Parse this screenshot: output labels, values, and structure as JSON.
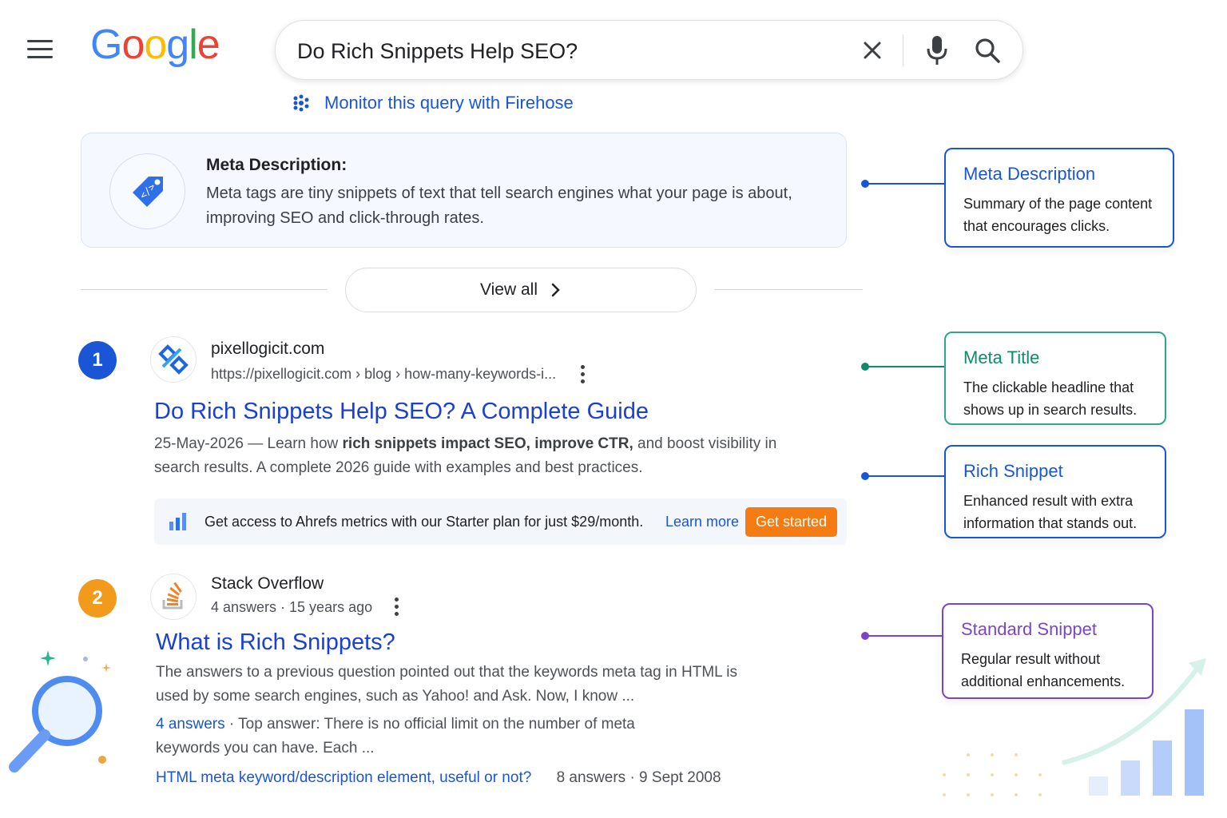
{
  "header": {
    "logo_letters": [
      "G",
      "o",
      "o",
      "g",
      "l",
      "e"
    ],
    "logo_colors": [
      "#4285F4",
      "#EA4335",
      "#FBBC05",
      "#4285F4",
      "#34A853",
      "#EA4335"
    ],
    "search_query": "Do Rich Snippets Help SEO?",
    "icons": [
      "menu-icon",
      "close-icon",
      "mic-icon",
      "search-icon"
    ]
  },
  "firehose": {
    "label": "Monitor this query with Firehose",
    "icon": "firehose-dots-icon"
  },
  "meta_card": {
    "label": "Meta Description:",
    "body": "Meta tags are tiny snippets of text that tell search engines what your page is about, improving SEO and click-through rates.",
    "icon": "code-tag-icon"
  },
  "view_all": {
    "label": "View all"
  },
  "results": [
    {
      "number": "1",
      "site": "pixellogicit.com",
      "url": "https://pixellogicit.com › blog › how-many-keywords-i...",
      "title": "Do Rich Snippets Help SEO? A Complete Guide",
      "date": "25-May-2026 — Learn how ",
      "bold1": "rich snippets impact SEO, improve CTR,",
      "snippet_mid": " and boost visibility in",
      "snippet_line2": "search results. A complete 2026 guide with examples and best practices.",
      "badge_color": "#1a55d6"
    },
    {
      "number": "2",
      "site": "Stack Overflow",
      "meta": "4 answers · 15 years ago",
      "title": "What is Rich Snippets?",
      "snippet_line1": "The answers to a previous question pointed out that the keywords meta tag in HTML is",
      "snippet_line2": "used by some search engines, such as Yahoo! and Ask. Now, I know ...",
      "answers_link": "4 answers",
      "top_answer_line1": " ·  Top answer: There is no official limit on the number of meta",
      "top_answer_line2": "keywords you can have. Each ...",
      "related_link": "HTML meta keyword/description element, useful or not?",
      "related_meta": "8 answers · 9 Sept 2008",
      "badge_color": "#f29a1c"
    }
  ],
  "ahrefs": {
    "text": "Get access to Ahrefs metrics with our Starter plan for just $29/month.",
    "learn_more": "Learn more",
    "cta": "Get started"
  },
  "annotations": [
    {
      "title": "Meta Description",
      "body": "Summary of the page content that encourages clicks.",
      "color": "#1a55d6"
    },
    {
      "title": "Meta Title",
      "body": "The clickable headline that shows up in search results.",
      "color": "#0f8a6a"
    },
    {
      "title": "Rich Snippet",
      "body": "Enhanced result with extra information that stands out.",
      "color": "#1a55d6"
    },
    {
      "title": "Standard Snippet",
      "body": "Regular result without additional enhancements.",
      "color": "#7a45c8"
    }
  ]
}
